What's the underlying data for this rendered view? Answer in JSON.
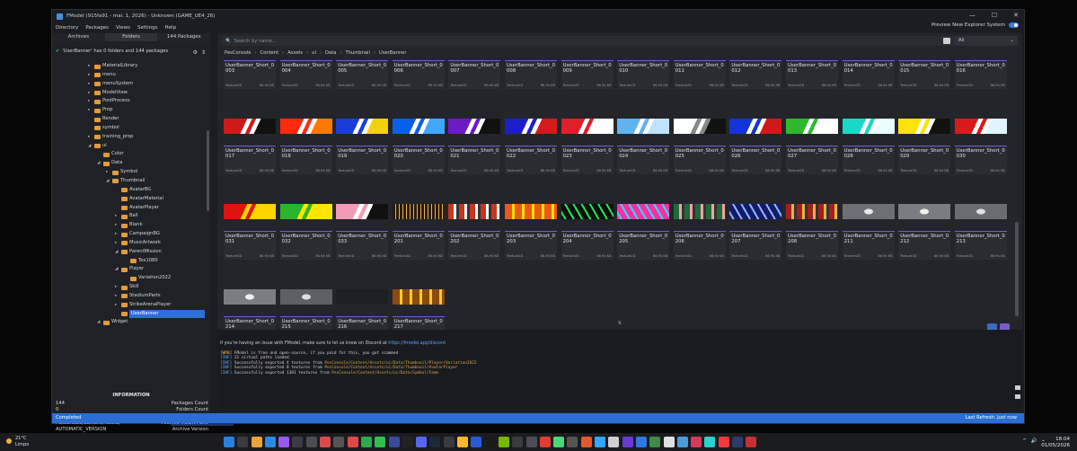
{
  "window": {
    "title": "FModel (915fa91 - mai. 1, 2026) - Unknown (GAME_UE4_26)",
    "controls": [
      "—",
      "☐",
      "✕"
    ]
  },
  "menu": [
    "Directory",
    "Packages",
    "Views",
    "Settings",
    "Help"
  ],
  "preview": {
    "label": "Preview New Explorer System",
    "enabled": true
  },
  "left_panel": {
    "tabs": [
      "Archives",
      "Folders",
      "144 Packages"
    ],
    "active_tab": "Folders",
    "loaded_text": "'UserBanner' has 0 folders and 144 packages",
    "tree": [
      {
        "label": "MaterialLibrary",
        "level": 0,
        "exp": false
      },
      {
        "label": "menu",
        "level": 0,
        "exp": false
      },
      {
        "label": "menuSystem",
        "level": 0,
        "exp": false
      },
      {
        "label": "ModelView",
        "level": 0,
        "exp": false
      },
      {
        "label": "PostProcess",
        "level": 0,
        "exp": false
      },
      {
        "label": "Prop",
        "level": 0,
        "exp": false
      },
      {
        "label": "Render",
        "level": 0,
        "exp": null
      },
      {
        "label": "symbol",
        "level": 0,
        "exp": null
      },
      {
        "label": "training_prop",
        "level": 0,
        "exp": false
      },
      {
        "label": "ui",
        "level": 0,
        "exp": true
      },
      {
        "label": "Color",
        "level": 1,
        "exp": null
      },
      {
        "label": "Data",
        "level": 1,
        "exp": true
      },
      {
        "label": "Symbol",
        "level": 2,
        "exp": false
      },
      {
        "label": "Thumbnail",
        "level": 2,
        "exp": true
      },
      {
        "label": "AvatarBG",
        "level": 3,
        "exp": null
      },
      {
        "label": "AvatarMaterial",
        "level": 3,
        "exp": null
      },
      {
        "label": "AvatarPlayer",
        "level": 3,
        "exp": null
      },
      {
        "label": "Ball",
        "level": 3,
        "exp": false
      },
      {
        "label": "Blank",
        "level": 3,
        "exp": false
      },
      {
        "label": "CampaignBG",
        "level": 3,
        "exp": false
      },
      {
        "label": "MusicArtwork",
        "level": 3,
        "exp": false
      },
      {
        "label": "ParentMission",
        "level": 3,
        "exp": true
      },
      {
        "label": "Tex1080",
        "level": 4,
        "exp": null
      },
      {
        "label": "Player",
        "level": 3,
        "exp": true
      },
      {
        "label": "Variation2022",
        "level": 4,
        "exp": null
      },
      {
        "label": "Skill",
        "level": 3,
        "exp": false
      },
      {
        "label": "StadiumParts",
        "level": 3,
        "exp": false
      },
      {
        "label": "StrikeArenaPlayer",
        "level": 3,
        "exp": false
      },
      {
        "label": "UserBanner",
        "level": 3,
        "exp": null,
        "selected": true
      },
      {
        "label": "Widget",
        "level": 1,
        "exp": true
      },
      {
        "label": "Capture",
        "level": 2,
        "exp": true
      },
      {
        "label": "CapturePlayerCard",
        "level": 3,
        "exp": null
      },
      {
        "label": "Contract",
        "level": 2,
        "exp": false
      },
      {
        "label": "Extra",
        "level": 2,
        "exp": false
      }
    ],
    "information": {
      "title": "INFORMATION",
      "rows": [
        {
          "value": "144",
          "key": "Packages Count"
        },
        {
          "value": "0",
          "key": "Folders Count"
        },
        {
          "value": "pc1000_console_win.utoc",
          "key": "Included In Archive"
        },
        {
          "value": "PesConsole/Content/Assets/",
          "key": "Archive Mount Point"
        },
        {
          "value": "AUTOMATIC_VERSION",
          "key": "Archive Version"
        }
      ]
    }
  },
  "search": {
    "placeholder": "Search by name...",
    "filter": "All"
  },
  "breadcrumb": [
    "PesConsole",
    "Content",
    "Assets",
    "ui",
    "Data",
    "Thumbnail",
    "UserBanner"
  ],
  "tile_type": "Texture2D",
  "tile_size": "86.94 KB",
  "rows": [
    {
      "kind": "tiles",
      "items": [
        "UserBanner_Short_0003",
        "UserBanner_Short_0004",
        "UserBanner_Short_0005",
        "UserBanner_Short_0006",
        "UserBanner_Short_0007",
        "UserBanner_Short_0008",
        "UserBanner_Short_0009",
        "UserBanner_Short_0010",
        "UserBanner_Short_0011",
        "UserBanner_Short_0012",
        "UserBanner_Short_0013",
        "UserBanner_Short_0014",
        "UserBanner_Short_0015",
        "UserBanner_Short_0016"
      ]
    },
    {
      "kind": "thumbs",
      "items": [
        {
          "bg": "#d01a1a",
          "stripe": "#ffffff",
          "dark": true
        },
        {
          "bg": "#ff2a0d",
          "stripe": "#ffffff",
          "end": "#ff7a00"
        },
        {
          "bg": "#1a3dd8",
          "stripe": "#ffffff",
          "end": "#f3d20a"
        },
        {
          "bg": "#0a5fe8",
          "stripe": "#ffffff",
          "end": "#40a8ff"
        },
        {
          "bg": "#6b1bc4",
          "stripe": "#ffffff",
          "dark": true
        },
        {
          "bg": "#1e1ec9",
          "stripe": "#ffffff",
          "end": "#d41a1a"
        },
        {
          "bg": "#e01f2a",
          "stripe": "#ffffff",
          "end": "#ffffff"
        },
        {
          "bg": "#5fb4f0",
          "stripe": "#ffffff",
          "end": "#bfe3ff"
        },
        {
          "bg": "#ffffff",
          "stripe": "#888888",
          "dark": true
        },
        {
          "bg": "#1434d8",
          "stripe": "#ffffff",
          "end": "#d01a1a"
        },
        {
          "bg": "#2eb82e",
          "stripe": "#ffffff",
          "end": "#ffffff"
        },
        {
          "bg": "#18d8c8",
          "stripe": "#ffffff",
          "end": "#e8fffd"
        },
        {
          "bg": "#ffe20a",
          "stripe": "#ffffff",
          "dark": true
        },
        {
          "bg": "#d81a1a",
          "stripe": "#ffffff",
          "end": "#dff5ff"
        }
      ]
    },
    {
      "kind": "tiles",
      "items": [
        "UserBanner_Short_0017",
        "UserBanner_Short_0018",
        "UserBanner_Short_0019",
        "UserBanner_Short_0020",
        "UserBanner_Short_0021",
        "UserBanner_Short_0022",
        "UserBanner_Short_0023",
        "UserBanner_Short_0024",
        "UserBanner_Short_0025",
        "UserBanner_Short_0026",
        "UserBanner_Short_0027",
        "UserBanner_Short_0028",
        "UserBanner_Short_0029",
        "UserBanner_Short_0030"
      ]
    },
    {
      "kind": "thumbs",
      "items": [
        {
          "bg": "#e0140e",
          "stripe": "#ffd400",
          "end": "#ffd400"
        },
        {
          "bg": "#2bb52b",
          "stripe": "#ffe600",
          "end": "#ffe600"
        },
        {
          "bg": "#f49ab8",
          "stripe": "#ffffff",
          "dark": true
        },
        {
          "bg": "#2a1a12",
          "stripe": "#e5b34a",
          "pattern": "lights"
        },
        {
          "bg": "#c8341f",
          "stripe": "#ffffff",
          "pattern": "art"
        },
        {
          "bg": "#e85a1a",
          "stripe": "#ffe000",
          "pattern": "text"
        },
        {
          "bg": "#0c120c",
          "stripe": "#29e35a",
          "pattern": "neon"
        },
        {
          "bg": "#ff2fa2",
          "stripe": "#24e0ff",
          "pattern": "neon"
        },
        {
          "bg": "#1d6b3a",
          "stripe": "#f5a0a0",
          "pattern": "art"
        },
        {
          "bg": "#141a6a",
          "stripe": "#8fb8ff",
          "pattern": "neon"
        },
        {
          "bg": "#a02020",
          "stripe": "#f0b040",
          "pattern": "art"
        },
        {
          "bg": "#6d6f74",
          "stripe": "#e8e8e8",
          "pattern": "leaf"
        },
        {
          "bg": "#7a7c81",
          "stripe": "#f0f0f0",
          "pattern": "leaf"
        },
        {
          "bg": "#6a6c71",
          "stripe": "#e0e0e0",
          "pattern": "leaf"
        }
      ]
    },
    {
      "kind": "tiles",
      "items": [
        "UserBanner_Short_0031",
        "UserBanner_Short_0032",
        "UserBanner_Short_0033",
        "UserBanner_Short_0201",
        "UserBanner_Short_0202",
        "UserBanner_Short_0203",
        "UserBanner_Short_0204",
        "UserBanner_Short_0205",
        "UserBanner_Short_0206",
        "UserBanner_Short_0207",
        "UserBanner_Short_0208",
        "UserBanner_Short_0211",
        "UserBanner_Short_0212",
        "UserBanner_Short_0213"
      ]
    },
    {
      "kind": "thumbs",
      "items": [
        {
          "bg": "#7b7d82",
          "stripe": "#eeeeee",
          "pattern": "leaf"
        },
        {
          "bg": "#5e6065",
          "stripe": "#dddddd",
          "pattern": "leaf"
        },
        {
          "bg": "#1e1f24",
          "stripe": "#2a2b30",
          "pattern": "blank"
        },
        {
          "bg": "#8a4a10",
          "stripe": "#ffc928",
          "pattern": "text"
        }
      ]
    },
    {
      "kind": "tiles",
      "items": [
        "UserBanner_Short_0214",
        "UserBanner_Short_0215",
        "UserBanner_Short_0216",
        "UserBanner_Short_0217"
      ]
    }
  ],
  "log": {
    "intro": "If you're having an issue with FModel, make sure to let us know on Discord at ",
    "intro_link": "https://fmodel.app/discord",
    "lines": [
      {
        "tag": "[WRN]",
        "text": " FModel is free and open-source, if you paid for this, you got scammed",
        "path": ""
      },
      {
        "tag": "[INF]",
        "text": " 31 virtual paths loaded",
        "path": ""
      },
      {
        "tag": "[INF]",
        "text": " Successfully exported 4 textures from ",
        "path": "PesConsole/Content/Assets/ui/Data/Thumbnail/Player/Variation2022"
      },
      {
        "tag": "[INF]",
        "text": " Successfully exported 8 textures from ",
        "path": "PesConsole/Content/Assets/ui/Data/Thumbnail/AvatarPlayer"
      },
      {
        "tag": "[INF]",
        "text": " Successfully exported 1301 textures from ",
        "path": "PesConsole/Content/Assets/ui/Data/Symbol/Fame"
      }
    ]
  },
  "status": {
    "left": "Completed",
    "right": "Last Refresh: Just now"
  },
  "behind_window_text": "Vetar",
  "taskbar": {
    "weather_temp": "21°C",
    "weather_desc": "Limpo",
    "time": "18:04",
    "date": "01/05/2026",
    "icon_colors": [
      "#2a7fe0",
      "#3a3b40",
      "#e8a33a",
      "#2b8ae0",
      "#9b59f0",
      "#3b3d44",
      "#4b4d55",
      "#d94b4b",
      "#555",
      "#e04848",
      "#2fa84f",
      "#2fbf4f",
      "#3a4a9a",
      "#222",
      "#5865f2",
      "#1b2838",
      "#3a3b40",
      "#ffb82e",
      "#2a5bd6",
      "#1a1a1a",
      "#76b900",
      "#3a3b40",
      "#4b4d55",
      "#e03c31",
      "#4bd67a",
      "#555",
      "#e35b2a",
      "#31a8ff",
      "#d0d0d0",
      "#6a3ad6",
      "#2f78e0",
      "#3f8a4a",
      "#e0e0e0",
      "#4b9bd8",
      "#d23c5a",
      "#2bd0d0",
      "#f03a3a",
      "#2a3a6a",
      "#c73030"
    ],
    "tray": [
      "^",
      "🔊",
      "⌁"
    ]
  }
}
